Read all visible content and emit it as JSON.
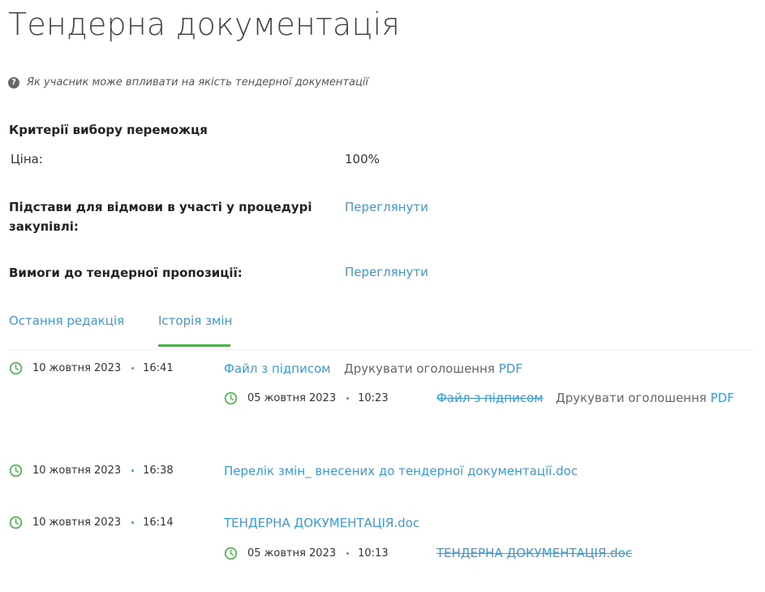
{
  "page": {
    "title": "Тендерна документація"
  },
  "help": {
    "icon": "question-circle-icon",
    "text": "Як учасник може впливати на якість тендерної документації"
  },
  "criteria": {
    "title": "Критерії вибору переможця",
    "price_label": "Ціна:",
    "price_value": "100%"
  },
  "refusal": {
    "label_line1": "Підстави для відмови в участі у процедурі",
    "label_line2": "закупівлі:",
    "link": "Переглянути"
  },
  "requirements": {
    "label": "Вимоги до тендерної пропозиції:",
    "link": "Переглянути"
  },
  "tabs": [
    {
      "label": "Остання редакція",
      "active": false
    },
    {
      "label": "Історія змін",
      "active": true
    }
  ],
  "history": [
    {
      "date": "10 жовтня 2023",
      "time": "16:41",
      "file": "Файл з підписом",
      "print_prefix": "Друкувати оголошення",
      "print_link": "PDF",
      "previous": {
        "date": "05 жовтня 2023",
        "time": "10:23",
        "file": "Файл з підписом",
        "print_prefix": "Друкувати оголошення",
        "print_link": "PDF"
      }
    },
    {
      "date": "10 жовтня 2023",
      "time": "16:38",
      "file": "Перелік змін_ внесених до тендерної документації.doc"
    },
    {
      "date": "10 жовтня 2023",
      "time": "16:14",
      "file": "ТЕНДЕРНА ДОКУМЕНТАЦІЯ.doc",
      "previous": {
        "date": "05 жовтня 2023",
        "time": "10:13",
        "file": "ТЕНДЕРНА ДОКУМЕНТАЦІЯ.doc"
      }
    }
  ],
  "colors": {
    "link": "#3a9ad1",
    "accent_green": "#4caf50"
  }
}
